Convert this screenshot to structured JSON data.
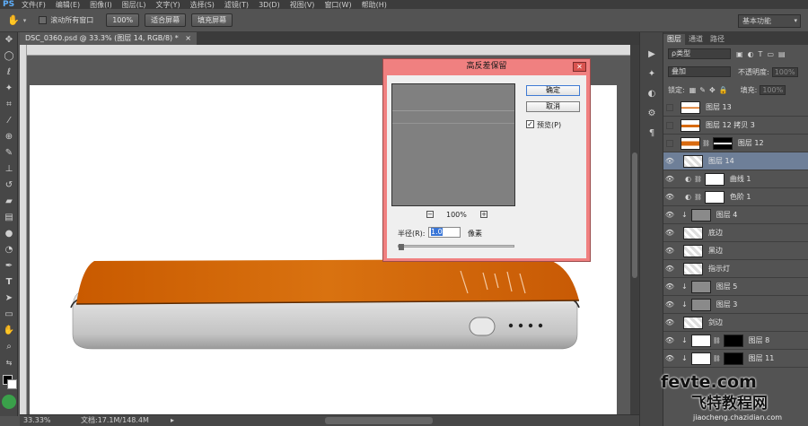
{
  "app": {
    "logo": "PS"
  },
  "menubar": {
    "items": [
      "文件(F)",
      "编辑(E)",
      "图像(I)",
      "图层(L)",
      "文字(Y)",
      "选择(S)",
      "滤镜(T)",
      "3D(D)",
      "视图(V)",
      "窗口(W)",
      "帮助(H)"
    ]
  },
  "options": {
    "scroll_all_label": "滚动所有窗口",
    "zoom_btn": "100%",
    "fit_screen_btn": "适合屏幕",
    "fill_screen_btn": "填充屏幕",
    "workspace": "基本功能"
  },
  "document": {
    "tab_title": "DSC_0360.psd @ 33.3% (图层 14, RGB/8) *"
  },
  "status": {
    "zoom": "33.33%",
    "doc_size": "文档:17.1M/148.4M"
  },
  "dialog": {
    "title": "高反差保留",
    "ok": "确定",
    "cancel": "取消",
    "preview_label": "预览(P)",
    "preview_zoom": "100%",
    "radius_label": "半径(R):",
    "radius_value": "1.0",
    "unit": "像素"
  },
  "layers_panel": {
    "tabs": [
      "图层",
      "通道",
      "路径"
    ],
    "filter_label": "ρ类型",
    "blend_mode": "叠加",
    "opacity_label": "不透明度:",
    "opacity_value": "100%",
    "lock_label": "锁定:",
    "fill_label": "填充:",
    "fill_value": "100%",
    "layers": [
      {
        "name": "图层 13"
      },
      {
        "name": "图层 12 拷贝 3"
      },
      {
        "name": "图层 12"
      },
      {
        "name": "图层 14"
      },
      {
        "name": "曲线 1"
      },
      {
        "name": "色阶 1"
      },
      {
        "name": "图层 4"
      },
      {
        "name": "底边"
      },
      {
        "name": "黑边"
      },
      {
        "name": "指示灯"
      },
      {
        "name": "图层 5"
      },
      {
        "name": "图层 3"
      },
      {
        "name": "剑边"
      },
      {
        "name": "图层 8"
      },
      {
        "name": "图层 11"
      }
    ]
  },
  "watermark": {
    "domain": "fevte.com",
    "cn": "飞特教程网",
    "url": "jiaocheng.chazidian.com"
  },
  "colors": {
    "orange": "#d86a10",
    "dialog_frame": "#f08080",
    "selected_layer": "#6e7f98",
    "workspace_bg": "#535353"
  }
}
